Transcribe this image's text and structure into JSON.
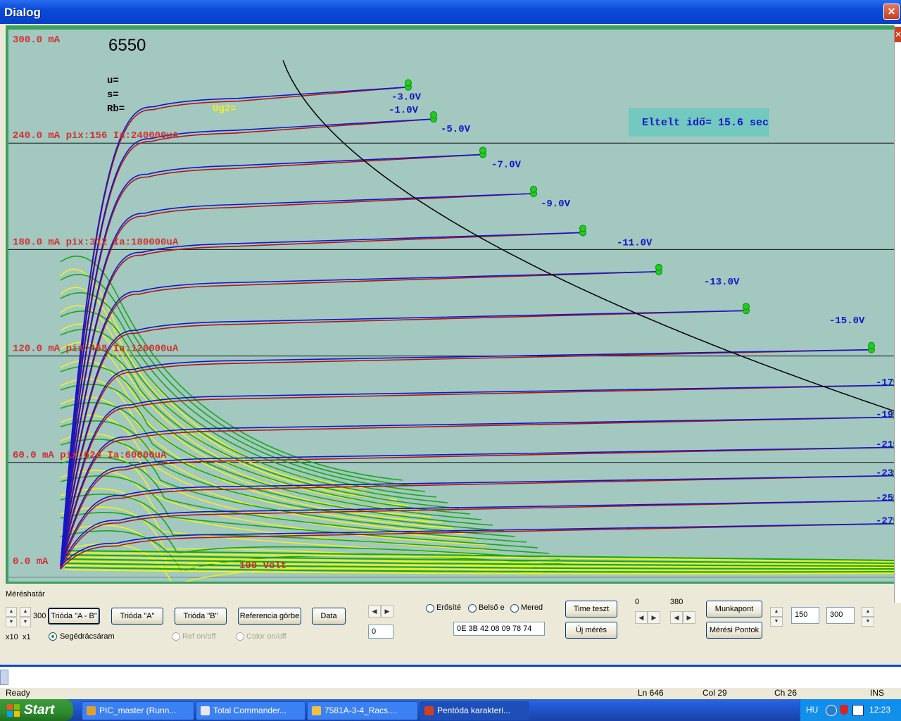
{
  "window": {
    "title": "Dialog",
    "close_glyph": "✕"
  },
  "plot": {
    "tube_name": "6550",
    "params": {
      "u": "u=",
      "s": "s=",
      "rb": "Rb="
    },
    "ug2_label": "Ug2=",
    "elapsed": "Eltelt idő= 15.6 sec",
    "bottom_label": "100 Volt",
    "grid_labels": [
      "300.0 mA",
      "240.0 mA pix:156 Ia:240000uA",
      "180.0 mA pix:312 Ia:180000uA",
      "120.0 mA pix:468 Ia:120000uA",
      "60.0 mA pix:624 Ia:60000uA",
      "0.0 mA"
    ],
    "curve_labels": [
      "-1.0V",
      "-3.0V",
      "-5.0V",
      "-7.0V",
      "-9.0V",
      "-11.0V",
      "-13.0V",
      "-15.0V",
      "-17",
      "-19",
      "-21",
      "-23",
      "-25",
      "-27"
    ]
  },
  "chart_data": {
    "type": "line",
    "title": "6550",
    "ylabel": "",
    "xlabel": "",
    "ylim": [
      0,
      300
    ],
    "y_unit": "mA",
    "grid_values": [
      0,
      60,
      120,
      180,
      240,
      300
    ],
    "series_colors": {
      "measured": "#1515c8",
      "reference": "#b01818",
      "triode_green": "#18a818",
      "triode_yellow": "#f0f020",
      "load_line": "#000000"
    },
    "series": [
      {
        "name": "-1.0V",
        "plateau_mA": 266
      },
      {
        "name": "-3.0V",
        "plateau_mA": 248
      },
      {
        "name": "-5.0V",
        "plateau_mA": 228
      },
      {
        "name": "-7.0V",
        "plateau_mA": 206
      },
      {
        "name": "-9.0V",
        "plateau_mA": 184
      },
      {
        "name": "-11.0V",
        "plateau_mA": 162
      },
      {
        "name": "-13.0V",
        "plateau_mA": 140
      },
      {
        "name": "-15.0V",
        "plateau_mA": 118
      },
      {
        "name": "-17",
        "plateau_mA": 98
      },
      {
        "name": "-19",
        "plateau_mA": 80
      },
      {
        "name": "-21",
        "plateau_mA": 63
      },
      {
        "name": "-23",
        "plateau_mA": 47
      },
      {
        "name": "-25",
        "plateau_mA": 33
      },
      {
        "name": "-27",
        "plateau_mA": 20
      }
    ]
  },
  "controls": {
    "merestartomany": "Méréshatár",
    "range_value": "300",
    "x10": "x10",
    "x1": "x1",
    "trioda_ab": "Trióda \"A - B\"",
    "trioda_a": "Trióda \"A\"",
    "trioda_b": "Trióda \"B\"",
    "referencia": "Referencia görbe",
    "data": "Data",
    "segedracs": "Segédrácsáram",
    "ref_onoff": "Ref on/off",
    "color_onoff": "Color on/off",
    "counter_value": "0",
    "erosite": "Erősíté",
    "belso": "Belső e",
    "mered": "Mered",
    "hex_value": "0E  3B 42 08 09 78 74",
    "time_teszt": "Time teszt",
    "uj_meres": "Új mérés",
    "range_lo": "0",
    "range_hi": "380",
    "munkapont": "Munkapont",
    "meresi_pontok": "Mérési Pontok",
    "val1": "150",
    "val2": "300"
  },
  "status": {
    "ready": "Ready",
    "ln": "Ln 646",
    "col": "Col 29",
    "ch": "Ch 26",
    "ins": "INS"
  },
  "taskbar": {
    "start": "Start",
    "tasks": [
      "PIC_master (Runn...",
      "Total Commander...",
      "7581A-3-4_Racs....",
      "Pentóda karakteri..."
    ],
    "lang": "HU",
    "time": "12:23"
  }
}
